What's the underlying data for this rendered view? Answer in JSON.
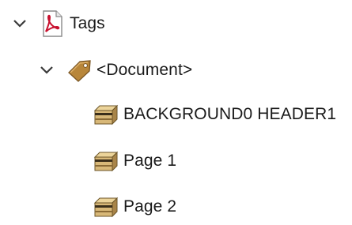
{
  "tree": {
    "root": {
      "label": "Tags",
      "icon": "pdf-document-icon",
      "expanded": true
    },
    "document": {
      "label": "<Document>",
      "icon": "tag-label-icon",
      "expanded": true
    },
    "children": [
      {
        "label": "BACKGROUND0 HEADER1",
        "icon": "box-container-icon"
      },
      {
        "label": "Page 1",
        "icon": "box-container-icon"
      },
      {
        "label": "Page 2",
        "icon": "box-container-icon"
      }
    ]
  },
  "colors": {
    "pdf_red": "#c8102e",
    "tag_brown": "#b8863a",
    "box_tan": "#d8b878",
    "chevron": "#3a3a3a"
  }
}
